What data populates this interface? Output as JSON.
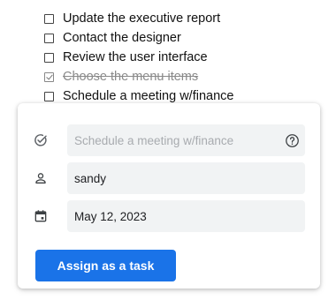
{
  "todos": [
    {
      "label": "Update the executive report",
      "checked": false
    },
    {
      "label": "Contact the designer",
      "checked": false
    },
    {
      "label": "Review the user interface",
      "checked": false
    },
    {
      "label": "Choose the menu items",
      "checked": true
    },
    {
      "label": "Schedule a meeting w/finance",
      "checked": false
    }
  ],
  "task_form": {
    "title_placeholder": "Schedule a meeting w/finance",
    "title_value": "",
    "assignee_value": "sandy",
    "date_value": "May 12, 2023",
    "assign_button_label": "Assign as a task"
  },
  "icons": {
    "title_icon": "check-circle-icon",
    "help_icon": "help-circle-icon",
    "assignee_icon": "person-icon",
    "date_icon": "calendar-icon"
  },
  "colors": {
    "accent": "#1a73e8",
    "field_bg": "#f1f3f4",
    "done_text": "#8a8a8a"
  }
}
